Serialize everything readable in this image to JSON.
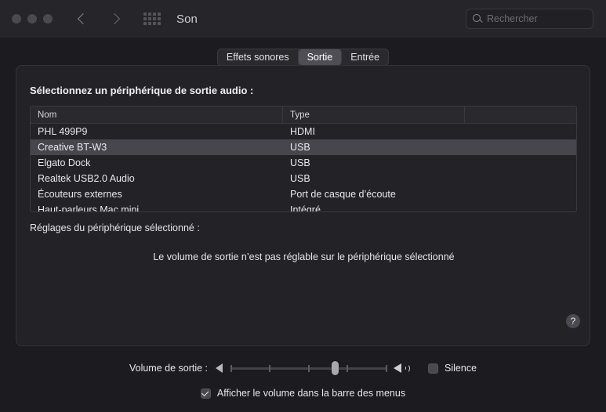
{
  "titlebar": {
    "title": "Son",
    "back_icon": "chevron-left-icon",
    "forward_icon": "chevron-right-icon",
    "grid_icon": "grid-apps-icon",
    "search": {
      "placeholder": "Rechercher",
      "value": "",
      "icon": "search-icon"
    }
  },
  "tabs": [
    {
      "label": "Effets sonores",
      "selected": false
    },
    {
      "label": "Sortie",
      "selected": true
    },
    {
      "label": "Entrée",
      "selected": false
    }
  ],
  "panel": {
    "select_device_label": "Sélectionnez un périphérique de sortie audio :",
    "table": {
      "columns": [
        "Nom",
        "Type",
        ""
      ],
      "rows": [
        {
          "name": "PHL 499P9",
          "type": "HDMI",
          "selected": false
        },
        {
          "name": "Creative BT-W3",
          "type": "USB",
          "selected": true
        },
        {
          "name": "Elgato Dock",
          "type": "USB",
          "selected": false
        },
        {
          "name": "Realtek USB2.0 Audio",
          "type": "USB",
          "selected": false
        },
        {
          "name": "Écouteurs externes",
          "type": "Port de casque d’écoute",
          "selected": false
        },
        {
          "name": "Haut-parleurs Mac mini",
          "type": "Intégré",
          "selected": false
        }
      ]
    },
    "settings_label": "Réglages du périphérique sélectionné :",
    "no_volume_message": "Le volume de sortie n’est pas réglable sur le périphérique sélectionné",
    "help_button": "?"
  },
  "bottom": {
    "volume_label": "Volume de sortie :",
    "volume_percent": 67,
    "speaker_min_icon": "speaker-low-icon",
    "speaker_max_icon": "speaker-high-icon",
    "mute": {
      "label": "Silence",
      "checked": false
    },
    "menubar": {
      "label": "Afficher le volume dans la barre des menus",
      "checked": true
    }
  },
  "colors": {
    "background": "#1c1b20",
    "titlebar": "#262529",
    "panel": "#232227",
    "selection": "#47464c",
    "text": "#e8e8ea"
  }
}
